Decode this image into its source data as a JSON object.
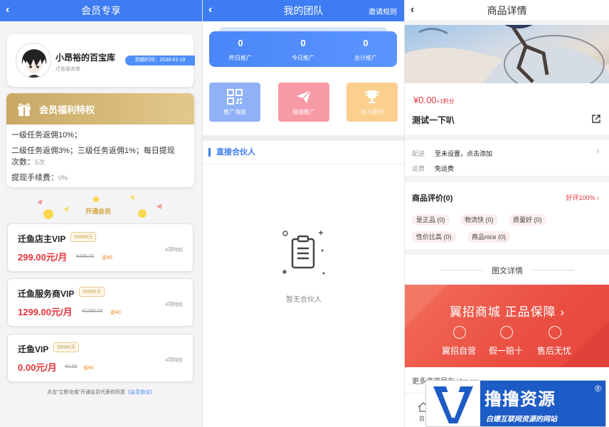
{
  "screen1": {
    "title": "会员专享",
    "profile": {
      "name": "小昂裕的百宝库",
      "role": "迁鱼服务商",
      "expire": "到期时间：2038-01-19"
    },
    "benefits": {
      "title": "会员福利特权",
      "line1": "一级任务返佣10%；",
      "line2a": "二级任务返佣3%；三级任务返佣1%；每日提现",
      "line2b": "次数：",
      "line2b_val": "5次",
      "line3": "提现手续费：",
      "line3_val": "0%"
    },
    "open_label": "开通会员",
    "vips": [
      {
        "name": "迁鱼店主VIP",
        "days": "99999天",
        "price": "299.00元/月",
        "orig": "¥299.00",
        "save": "省¥0",
        "count": "4项特权"
      },
      {
        "name": "迁鱼服务商VIP",
        "days": "99999天",
        "price": "1299.00元/月",
        "orig": "¥1299.00",
        "save": "省¥0",
        "count": "4项特权"
      },
      {
        "name": "迁鱼VIP",
        "days": "99999天",
        "price": "0.00元/月",
        "orig": "¥0.00",
        "save": "省¥0",
        "count": "4项特权"
      }
    ],
    "agree_text": "点击\"立即充值\"开通会员代表你同意",
    "agree_link": "《会员协议》"
  },
  "screen2": {
    "title": "我的团队",
    "rule_link": "邀请规则",
    "stats": [
      {
        "num": "0",
        "label": "昨日推广"
      },
      {
        "num": "0",
        "label": "今日推广"
      },
      {
        "num": "0",
        "label": "总计推广"
      }
    ],
    "tiles": [
      {
        "label": "推广海报",
        "color": "#8fb1f7"
      },
      {
        "label": "链接推广",
        "color": "#f79aa6"
      },
      {
        "label": "达人排行",
        "color": "#fbd08f"
      }
    ],
    "partner_title": "直接合伙人",
    "empty_text": "暂无合伙人"
  },
  "screen3": {
    "title": "商品详情",
    "price": "¥0.00",
    "points": "+1积分",
    "product_title": "测试一下叭",
    "ship_label": "配送",
    "ship_value": "至未设置，点击添加",
    "fee_label": "运费",
    "fee_value": "免运费",
    "review_title": "商品评价(0)",
    "review_good": "好评100%",
    "chips": [
      "是正品 (0)",
      "物流快 (0)",
      "质量好 (0)",
      "性价比高 (0)",
      "商品nice (0)"
    ],
    "detail_title": "图文详情",
    "banner_title": "翼招商城 正品保障",
    "banner_items": [
      "翼招自营",
      "假一赔十",
      "售后无忧"
    ],
    "more_text": "更多资源尽在 i4m.cn",
    "home_label": "首"
  },
  "watermark": {
    "title": "撸撸资源",
    "reg": "®",
    "subtitle": "白嫖互联网资源的网站"
  }
}
